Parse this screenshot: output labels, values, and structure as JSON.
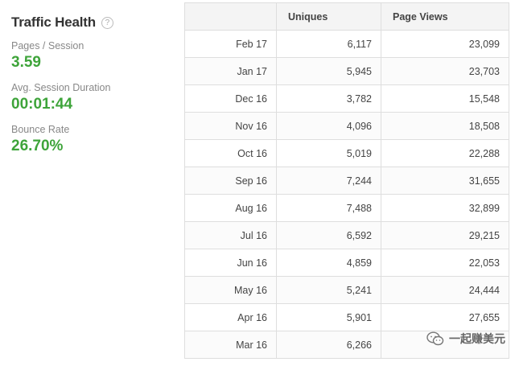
{
  "panel": {
    "title": "Traffic Health",
    "help_glyph": "?",
    "metrics": [
      {
        "label": "Pages / Session",
        "value": "3.59"
      },
      {
        "label": "Avg. Session Duration",
        "value": "00:01:44"
      },
      {
        "label": "Bounce Rate",
        "value": "26.70%"
      }
    ],
    "accent_color": "#3ea43a"
  },
  "table": {
    "headers": [
      "",
      "Uniques",
      "Page Views"
    ],
    "rows": [
      {
        "month": "Feb 17",
        "uniques": "6,117",
        "page_views": "23,099"
      },
      {
        "month": "Jan 17",
        "uniques": "5,945",
        "page_views": "23,703"
      },
      {
        "month": "Dec 16",
        "uniques": "3,782",
        "page_views": "15,548"
      },
      {
        "month": "Nov 16",
        "uniques": "4,096",
        "page_views": "18,508"
      },
      {
        "month": "Oct 16",
        "uniques": "5,019",
        "page_views": "22,288"
      },
      {
        "month": "Sep 16",
        "uniques": "7,244",
        "page_views": "31,655"
      },
      {
        "month": "Aug 16",
        "uniques": "7,488",
        "page_views": "32,899"
      },
      {
        "month": "Jul 16",
        "uniques": "6,592",
        "page_views": "29,215"
      },
      {
        "month": "Jun 16",
        "uniques": "4,859",
        "page_views": "22,053"
      },
      {
        "month": "May 16",
        "uniques": "5,241",
        "page_views": "24,444"
      },
      {
        "month": "Apr 16",
        "uniques": "5,901",
        "page_views": "27,655"
      },
      {
        "month": "Mar 16",
        "uniques": "6,266",
        "page_views": ""
      }
    ]
  },
  "watermark": {
    "text": "一起赚美元",
    "icon": "wechat-logo-icon"
  }
}
